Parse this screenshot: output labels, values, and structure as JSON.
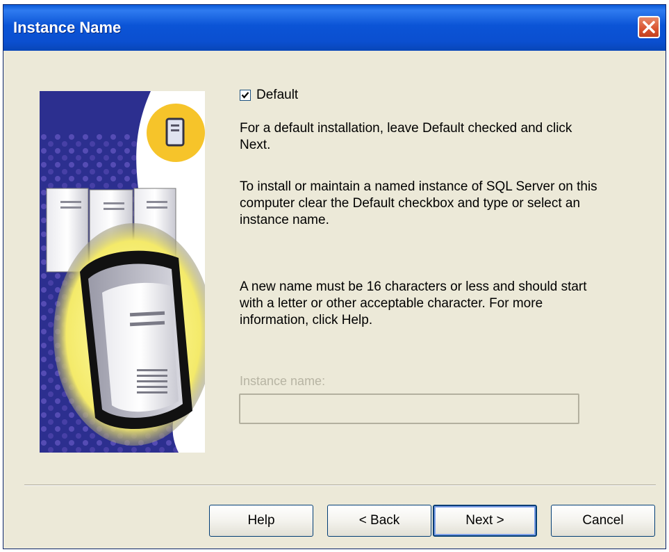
{
  "window": {
    "title": "Instance Name"
  },
  "checkbox": {
    "label": "Default",
    "checked": true
  },
  "paragraphs": {
    "p1": "For a default installation, leave Default checked and click Next.",
    "p2": "To install or maintain a named instance of SQL Server on this computer clear the Default checkbox and type or select an instance name.",
    "p3": "A new name must be 16 characters or less and should start with a letter or other acceptable character.  For more information, click Help."
  },
  "instance": {
    "label": "Instance name:",
    "value": ""
  },
  "buttons": {
    "help": "Help",
    "back": "< Back",
    "next": "Next >",
    "cancel": "Cancel"
  },
  "icons": {
    "close": "close-icon",
    "checkmark": "checkmark-icon",
    "server_badge": "server-icon",
    "illustration": "servers-illustration"
  },
  "colors": {
    "titlebar": "#0b54d6",
    "dialog_bg": "#ece9d8",
    "close": "#d9532f",
    "art_bg": "#2c2f8f"
  }
}
